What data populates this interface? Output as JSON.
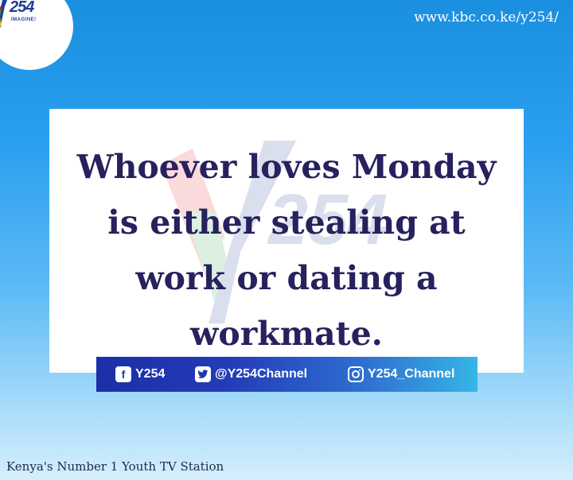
{
  "logo": {
    "number": "254",
    "tagline": "IMAGINE!"
  },
  "url": "www.kbc.co.ke/y254/",
  "quote": "Whoever loves Monday is either stealing at work or dating a workmate.",
  "social": {
    "facebook": {
      "icon": "facebook-icon",
      "handle": "Y254"
    },
    "twitter": {
      "icon": "twitter-icon",
      "handle": "@Y254Channel"
    },
    "instagram": {
      "icon": "instagram-icon",
      "handle": "Y254_Channel"
    }
  },
  "footer": "Kenya's Number 1 Youth TV Station",
  "colors": {
    "quote_text": "#27215e",
    "brand_blue": "#1f3f96",
    "social_bar_start": "#1b2fa6",
    "social_bar_end": "#35b6e6"
  }
}
